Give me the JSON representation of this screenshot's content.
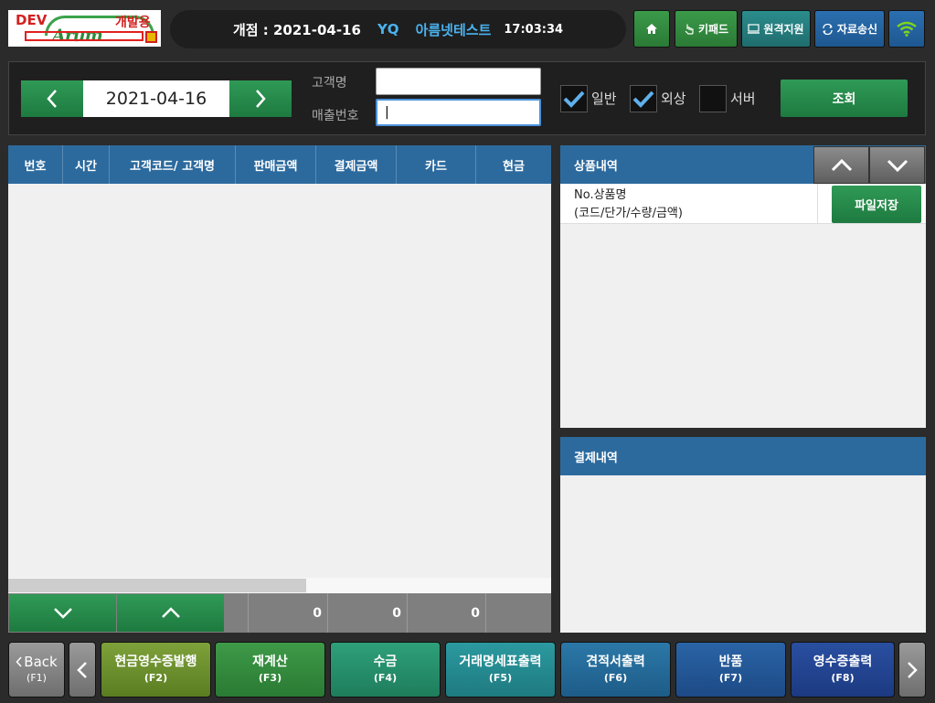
{
  "logo": {
    "dev": "DEV",
    "kr": "개발용",
    "brand": "Arum"
  },
  "status": {
    "open_label": "개점 : 2021-04-16",
    "store": "YQ",
    "user": "아름넷테스트",
    "time": "17:03:34"
  },
  "top_buttons": {
    "keypad": "키패드",
    "remote": "원격지원",
    "send": "자료송신"
  },
  "search": {
    "date": "2021-04-16",
    "customer_label": "고객명",
    "sales_no_label": "매출번호",
    "customer_value": "",
    "sales_no_value": "|",
    "chk_general": "일반",
    "chk_credit": "외상",
    "chk_server": "서버",
    "query_button": "조회"
  },
  "table": {
    "columns": [
      "번호",
      "시간",
      "고객코드/ 고객명",
      "판매금액",
      "결제금액",
      "카드",
      "현금"
    ],
    "totals": [
      "0",
      "0",
      "0"
    ]
  },
  "product_panel": {
    "title": "상품내역",
    "row_line1": "No.상품명",
    "row_line2": "(코드/단가/수량/금액)",
    "save_button": "파일저장"
  },
  "payment_panel": {
    "title": "결제내역"
  },
  "fbar": {
    "back": "Back",
    "back_key": "(F1)",
    "f2": "현금영수증발행",
    "f2_key": "(F2)",
    "f3": "재계산",
    "f3_key": "(F3)",
    "f4": "수금",
    "f4_key": "(F4)",
    "f5": "거래명세표출력",
    "f5_key": "(F5)",
    "f6": "견적서출력",
    "f6_key": "(F6)",
    "f7": "반품",
    "f7_key": "(F7)",
    "f8": "영수증출력",
    "f8_key": "(F8)"
  },
  "colors": {
    "header_blue": "#2c6a9e",
    "action_green": "#2a8a4c",
    "status_blue": "#4ab3f0"
  }
}
